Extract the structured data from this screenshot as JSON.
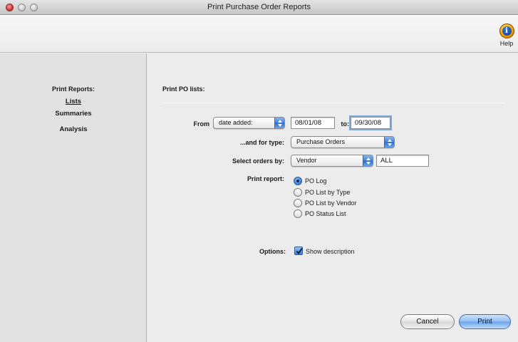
{
  "window": {
    "title": "Print Purchase Order Reports"
  },
  "toolbar": {
    "help_label": "Help",
    "help_icon": "info-icon"
  },
  "sidebar": {
    "heading": "Print Reports:",
    "items": [
      {
        "label": "Lists",
        "active": true
      },
      {
        "label": "Summaries",
        "active": false
      },
      {
        "label": "Analysis",
        "active": false
      }
    ]
  },
  "main": {
    "section_title": "Print PO lists:",
    "from": {
      "label": "From",
      "field_value": "date added:",
      "start_date": "08/01/08",
      "to_label": "to:",
      "end_date": "09/30/08"
    },
    "type": {
      "label": "...and for type:",
      "value": "Purchase Orders"
    },
    "select_by": {
      "label": "Select orders by:",
      "value": "Vendor",
      "filter": "ALL"
    },
    "print_report": {
      "label": "Print report:",
      "options": [
        {
          "label": "PO Log",
          "selected": true
        },
        {
          "label": "PO List by Type",
          "selected": false
        },
        {
          "label": "PO List by Vendor",
          "selected": false
        },
        {
          "label": "PO Status List",
          "selected": false
        }
      ]
    },
    "options": {
      "label": "Options:",
      "show_description_label": "Show description",
      "show_description_checked": true
    }
  },
  "buttons": {
    "cancel": "Cancel",
    "print": "Print"
  },
  "colors": {
    "accent": "#3a79d6",
    "close_button": "#d13b3b",
    "help_icon": "#f5a300"
  }
}
